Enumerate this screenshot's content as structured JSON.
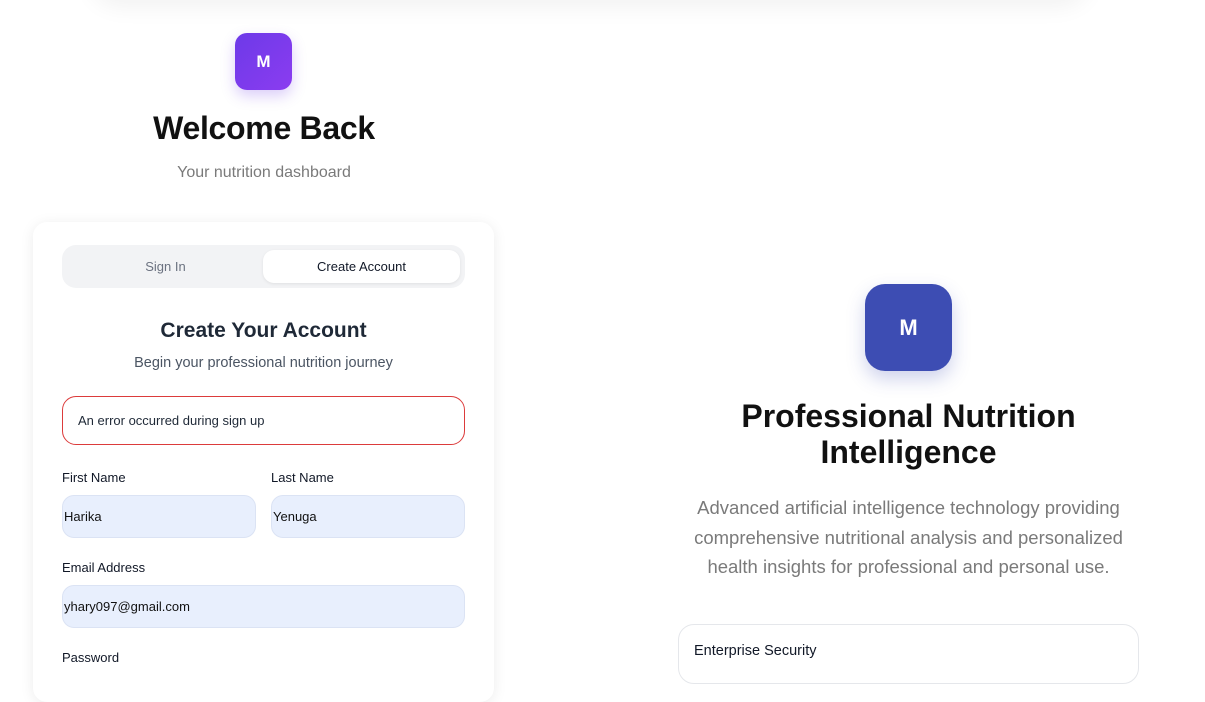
{
  "header": {
    "logo_letter": "M",
    "title": "Welcome Back",
    "subtitle": "Your nutrition dashboard"
  },
  "auth": {
    "tabs": [
      {
        "label": "Sign In",
        "active": false
      },
      {
        "label": "Create Account",
        "active": true
      }
    ],
    "title": "Create Your Account",
    "subtitle": "Begin your professional nutrition journey",
    "error": "An error occurred during sign up",
    "fields": {
      "first_name": {
        "label": "First Name",
        "value": "Harika"
      },
      "last_name": {
        "label": "Last Name",
        "value": "Yenuga"
      },
      "email": {
        "label": "Email Address",
        "value": "yhary097@gmail.com"
      },
      "password": {
        "label": "Password"
      }
    }
  },
  "promo": {
    "logo_letter": "M",
    "title_line1": "Professional Nutrition",
    "title_line2": "Intelligence",
    "description": "Advanced artificial intelligence technology providing comprehensive nutritional analysis and personalized health insights for professional and personal use.",
    "features": [
      {
        "title": "Enterprise Security"
      }
    ]
  },
  "colors": {
    "brand_purple": "#7139ec",
    "brand_blue": "#3d4db3",
    "error_red": "#dc3b3b",
    "input_bg": "#e8effd"
  }
}
